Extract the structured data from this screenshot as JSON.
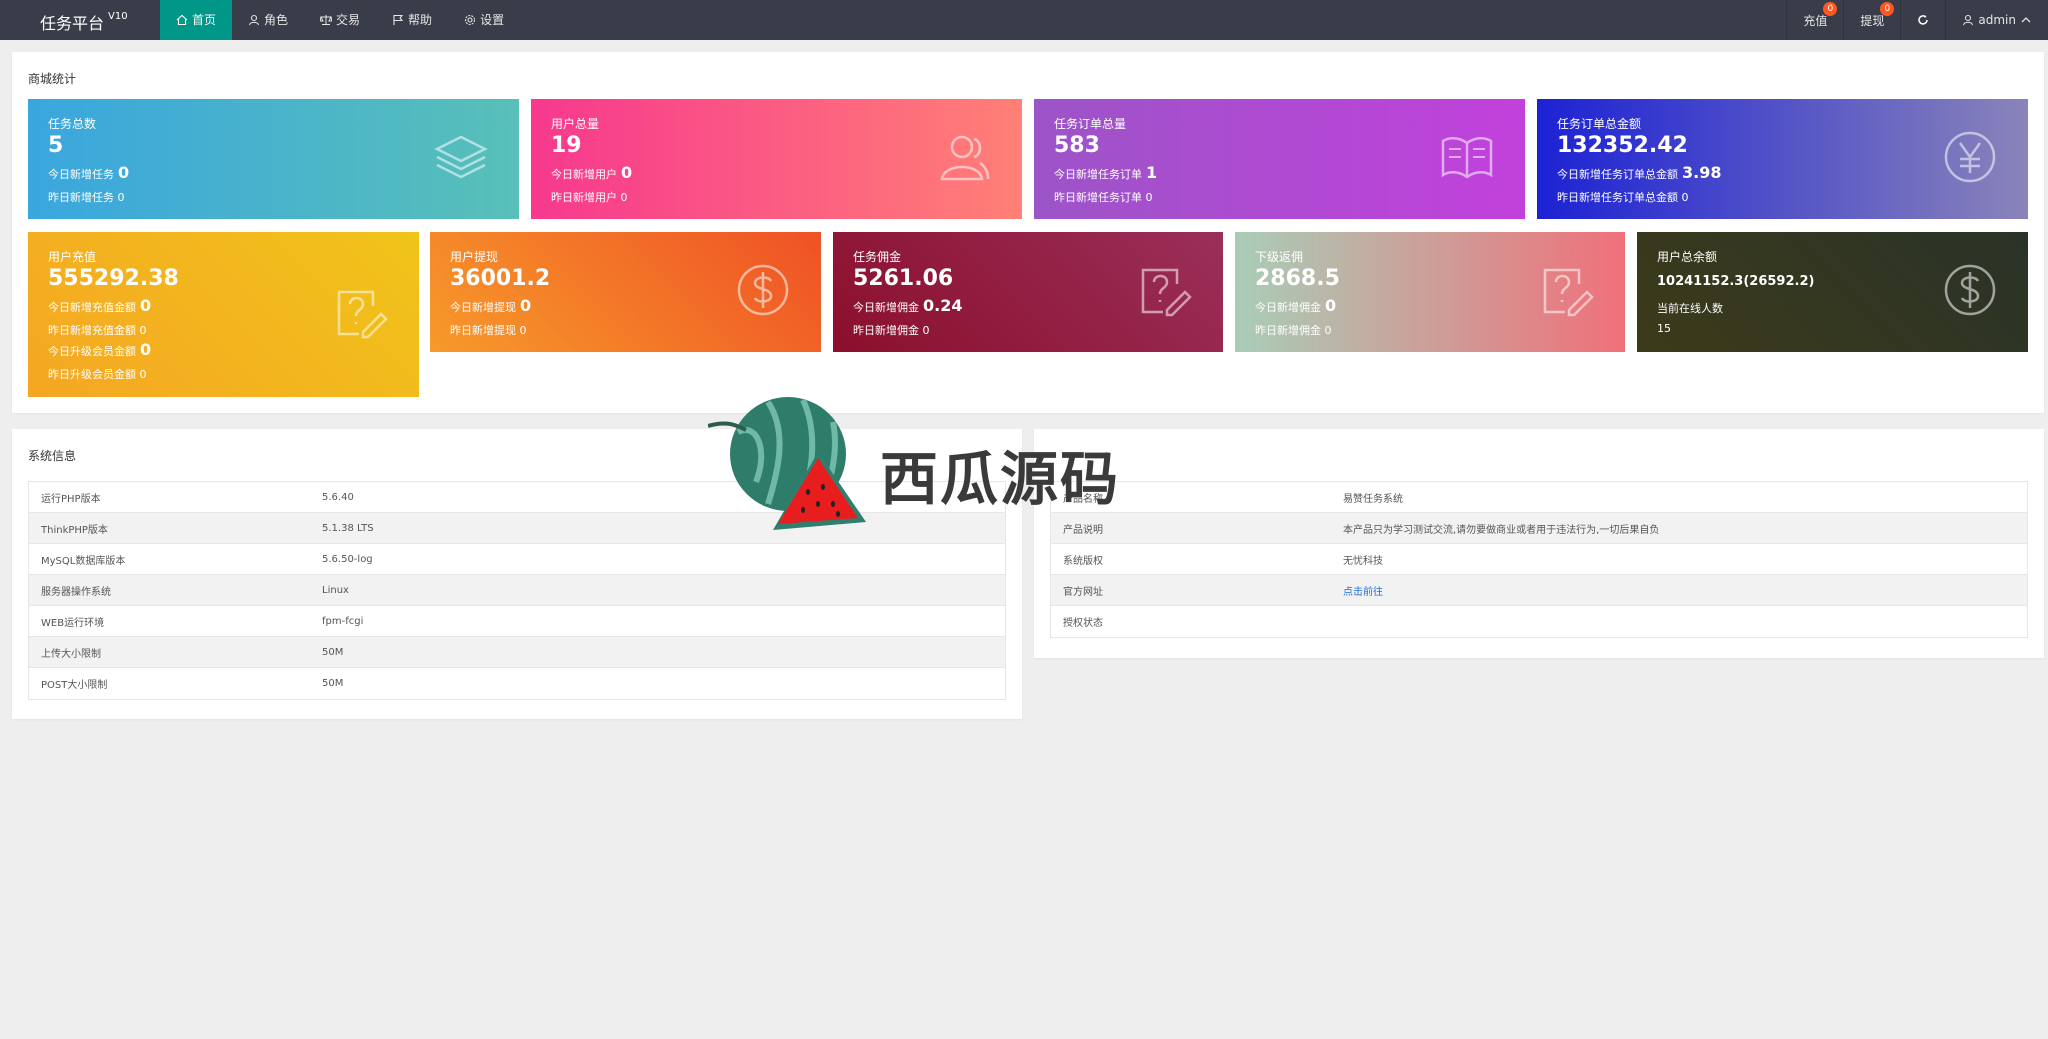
{
  "header": {
    "brand": "任务平台",
    "version": "V10",
    "nav": [
      {
        "label": "首页",
        "icon": "home-icon",
        "active": true
      },
      {
        "label": "角色",
        "icon": "user-icon",
        "active": false
      },
      {
        "label": "交易",
        "icon": "scale-icon",
        "active": false
      },
      {
        "label": "帮助",
        "icon": "flag-icon",
        "active": false
      },
      {
        "label": "设置",
        "icon": "gear-icon",
        "active": false
      }
    ],
    "recharge_label": "充值",
    "recharge_badge": "0",
    "withdraw_label": "提现",
    "withdraw_badge": "0",
    "refresh_icon": "refresh-icon",
    "user_label": "admin"
  },
  "stats": {
    "title": "商城统计",
    "cards": [
      {
        "title": "任务总数",
        "value": "5",
        "l1": "今日新增任务",
        "l1v": "0",
        "l2": "昨日新增任务",
        "l2v": "0",
        "icon": "layers-icon",
        "c1": "#3aa6de",
        "c2": "#58c0b8"
      },
      {
        "title": "用户总量",
        "value": "19",
        "l1": "今日新增用户",
        "l1v": "0",
        "l2": "昨日新增用户",
        "l2v": "0",
        "icon": "users-icon",
        "c1": "#f7388e",
        "c2": "#ff8076"
      },
      {
        "title": "任务订单总量",
        "value": "583",
        "l1": "今日新增任务订单",
        "l1v": "1",
        "l2": "昨日新增任务订单",
        "l2v": "0",
        "icon": "book-icon",
        "c1": "#9c54c8",
        "c2": "#c241dc"
      },
      {
        "title": "任务订单总金额",
        "value": "132352.42",
        "l1": "今日新增任务订单总金额",
        "l1v": "3.98",
        "l2": "昨日新增任务订单总金额",
        "l2v": "0",
        "icon": "yen-icon",
        "c1": "#1c22d4",
        "c2": "#8a84ba"
      },
      {
        "title": "用户充值",
        "value": "555292.38",
        "l1": "今日新增充值金额",
        "l1v": "0",
        "l2": "昨日新增充值金额",
        "l2v": "0",
        "l3": "今日升级会员金额",
        "l3v": "0",
        "l4": "昨日升级会员金额",
        "l4v": "0",
        "icon": "help-edit-icon",
        "c1": "#f5a623",
        "c2": "#f0c419"
      },
      {
        "title": "用户提现",
        "value": "36001.2",
        "l1": "今日新增提现",
        "l1v": "0",
        "l2": "昨日新增提现",
        "l2v": "0",
        "icon": "dollar-icon",
        "c1": "#f79a2a",
        "c2": "#ef5126"
      },
      {
        "title": "任务佣金",
        "value": "5261.06",
        "l1": "今日新增佣金",
        "l1v": "0.24",
        "l2": "昨日新增佣金",
        "l2v": "0",
        "icon": "help-edit-icon",
        "c1": "#8b0f2c",
        "c2": "#9a2f5a"
      },
      {
        "title": "下级返佣",
        "value": "2868.5",
        "l1": "今日新增佣金",
        "l1v": "0",
        "l2": "昨日新增佣金",
        "l2v": "0",
        "icon": "help-edit-icon",
        "c1": "#a9cdb7",
        "c2": "#f0707a"
      },
      {
        "title": "用户总余额",
        "value": "10241152.3(26592.2)",
        "l1": "当前在线人数",
        "l2": "15",
        "icon": "dollar-icon",
        "c1": "#3c3a1a",
        "c2": "#2a3328"
      }
    ]
  },
  "system": {
    "title": "系统信息",
    "rows": [
      {
        "k": "运行PHP版本",
        "v": "5.6.40"
      },
      {
        "k": "ThinkPHP版本",
        "v": "5.1.38 LTS"
      },
      {
        "k": "MySQL数据库版本",
        "v": "5.6.50-log"
      },
      {
        "k": "服务器操作系统",
        "v": "Linux"
      },
      {
        "k": "WEB运行环境",
        "v": "fpm-fcgi"
      },
      {
        "k": "上传大小限制",
        "v": "50M"
      },
      {
        "k": "POST大小限制",
        "v": "50M"
      }
    ]
  },
  "product": {
    "rows": [
      {
        "k": "产品名称",
        "v": "易赞任务系统"
      },
      {
        "k": "产品说明",
        "v": "本产品只为学习测试交流,请勿要做商业或者用于违法行为,一切后果自负"
      },
      {
        "k": "系统版权",
        "v": "无忧科技"
      },
      {
        "k": "官方网址",
        "v": "点击前往"
      },
      {
        "k": "授权状态",
        "v": ""
      }
    ]
  },
  "watermark": {
    "text": "西瓜源码"
  }
}
